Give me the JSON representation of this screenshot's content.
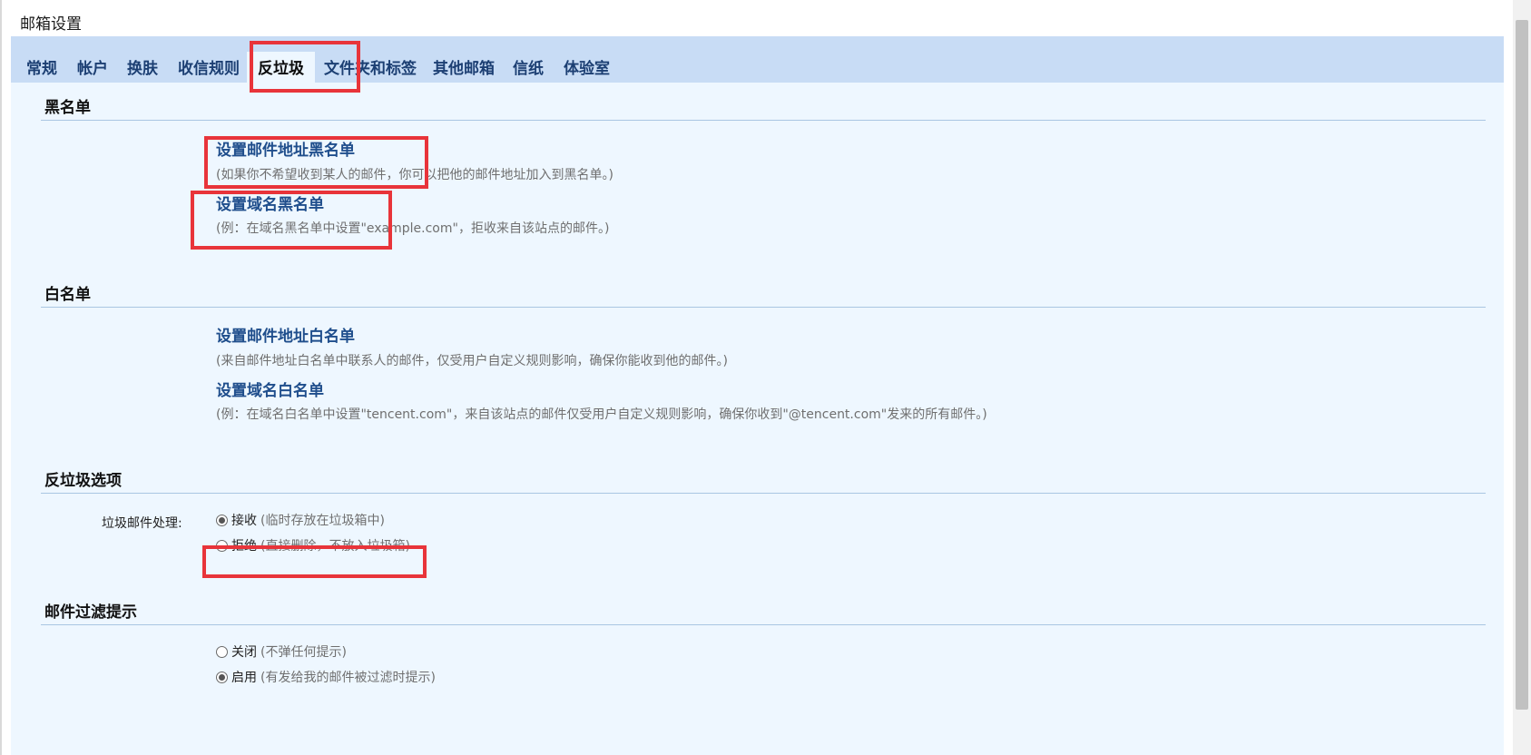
{
  "page_title": "邮箱设置",
  "tabs": [
    {
      "label": "常规",
      "active": false
    },
    {
      "label": "帐户",
      "active": false
    },
    {
      "label": "换肤",
      "active": false
    },
    {
      "label": "收信规则",
      "active": false
    },
    {
      "label": "反垃圾",
      "active": true
    },
    {
      "label": "文件夹和标签",
      "active": false
    },
    {
      "label": "其他邮箱",
      "active": false
    },
    {
      "label": "信纸",
      "active": false
    },
    {
      "label": "体验室",
      "active": false
    }
  ],
  "blacklist": {
    "title": "黑名单",
    "address_link": "设置邮件地址黑名单",
    "address_desc": "(如果你不希望收到某人的邮件，你可以把他的邮件地址加入到黑名单。)",
    "domain_link": "设置域名黑名单",
    "domain_desc": "(例：在域名黑名单中设置\"example.com\"，拒收来自该站点的邮件。)"
  },
  "whitelist": {
    "title": "白名单",
    "address_link": "设置邮件地址白名单",
    "address_desc": "(来自邮件地址白名单中联系人的邮件，仅受用户自定义规则影响，确保你能收到他的邮件。)",
    "domain_link": "设置域名白名单",
    "domain_desc": "(例：在域名白名单中设置\"tencent.com\"，来自该站点的邮件仅受用户自定义规则影响，确保你收到\"@tencent.com\"发来的所有邮件。)"
  },
  "antispam": {
    "title": "反垃圾选项",
    "label": "垃圾邮件处理:",
    "options": [
      {
        "label": "接收",
        "hint": "(临时存放在垃圾箱中)",
        "checked": true
      },
      {
        "label": "拒绝",
        "hint": "(直接删除，不放入垃圾箱)",
        "checked": false
      }
    ]
  },
  "filter_hint": {
    "title": "邮件过滤提示",
    "options": [
      {
        "label": "关闭",
        "hint": "(不弹任何提示)",
        "checked": false
      },
      {
        "label": "启用",
        "hint": "(有发给我的邮件被过滤时提示)",
        "checked": true
      }
    ]
  },
  "colors": {
    "tabbar": "#c8dcf5",
    "panel": "#eef7ff",
    "link": "#1f4e8c",
    "highlight": "#e8343a"
  }
}
